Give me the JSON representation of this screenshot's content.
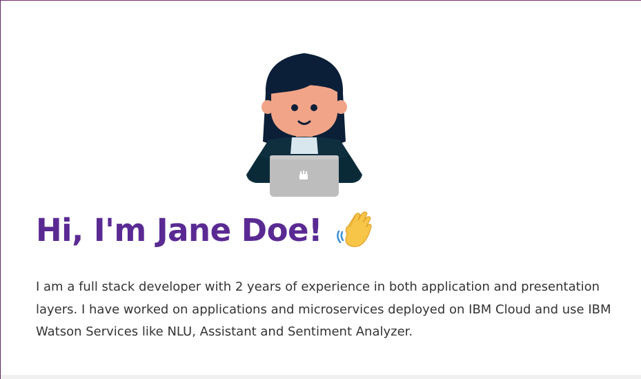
{
  "hero": {
    "title": "Hi, I'm Jane Doe!",
    "wave_icon": "waving-hand-emoji",
    "bio": "I am a full stack developer with 2 years of experience in both application and presentation layers. I have worked on applications and microservices deployed on IBM Cloud and use IBM Watson Services like NLU, Assistant and Sentiment Analyzer.",
    "avatar_icon": "developer-avatar-with-laptop"
  },
  "colors": {
    "title": "#5a2a93",
    "text": "#333333",
    "hair": "#0b1f38",
    "skin": "#f2a488",
    "jacket": "#0f2f3f",
    "laptop": "#bdbdbd"
  }
}
